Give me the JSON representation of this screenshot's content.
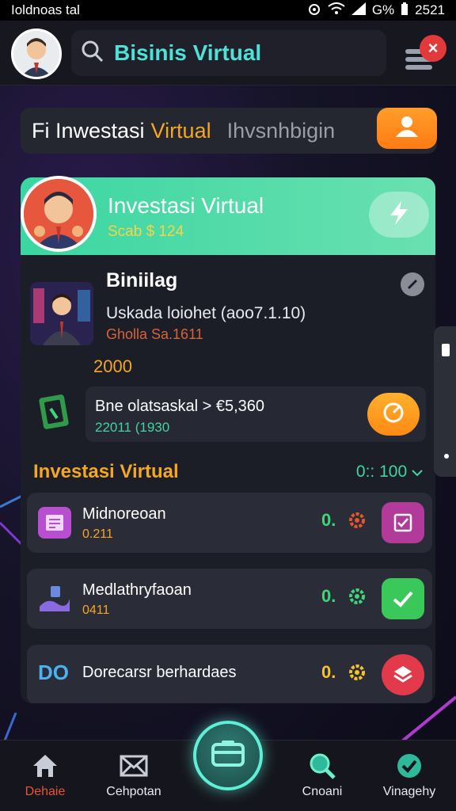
{
  "status_bar": {
    "left_text": "Ioldnoas tal",
    "battery": "G%",
    "time": "2521"
  },
  "header": {
    "search_text": "Bisinis Virtual",
    "close_label": "×"
  },
  "hero": {
    "text_white": "Fi Inwestasi",
    "text_orange": "Virtual",
    "text_gray": "Ihvsnhbigin"
  },
  "card": {
    "title": "Investasi Virtual",
    "subtitle": "Scab $ 124",
    "profile": {
      "name": "Biniilag",
      "line1": "Uskada loiohet (aoo7.1.10)",
      "line2": "Gholla Sa.1611",
      "amount": "2000"
    },
    "balance": {
      "main": "Bne olatsaskal > €5,360",
      "sub": "22011 (1930"
    },
    "section": {
      "title": "Investasi Virtual",
      "right": "0:: 100"
    },
    "items": [
      {
        "title": "Midnoreoan",
        "sub": "0.211",
        "value": "0.",
        "value_color": "#3fd67a",
        "gear_color": "#e8552c",
        "action_color": "#b23a9a",
        "icon_color": "#b84fd0"
      },
      {
        "title": "Medlathryfaoan",
        "sub": "0411",
        "value": "0.",
        "value_color": "#3fd67a",
        "gear_color": "#3fd67a",
        "action_color": "#3ac85a",
        "icon_color": "#8a6ae0"
      },
      {
        "title": "Dorecarsr berhardaes",
        "prefix": "DO",
        "value": "0.",
        "value_color": "#f5c42a",
        "gear_color": "#f5c42a",
        "action_color": "#e23a4a"
      }
    ]
  },
  "nav": {
    "items": [
      {
        "label": "Dehaie",
        "color": "#e8552c"
      },
      {
        "label": "Cehpotan",
        "color": "#e8eaf0"
      },
      {
        "label": "Cnoani",
        "color": "#e8eaf0"
      },
      {
        "label": "Vinagehy",
        "color": "#e8eaf0"
      }
    ]
  },
  "colors": {
    "accent_teal": "#4fe0d6",
    "accent_orange": "#f5a623",
    "accent_green": "#3fd6a0"
  }
}
